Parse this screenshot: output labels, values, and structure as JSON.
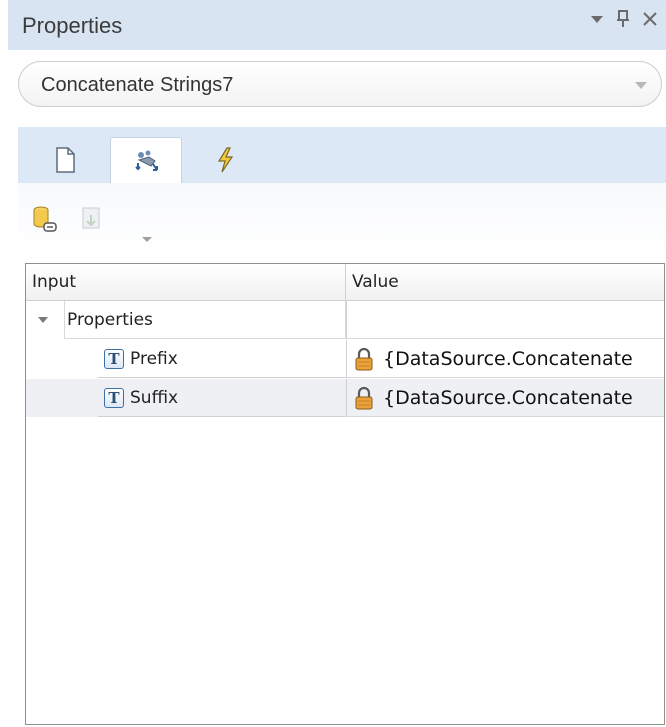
{
  "panel": {
    "title": "Properties",
    "controls": [
      "dropdown-menu-icon",
      "pin-icon",
      "close-icon"
    ]
  },
  "selector": {
    "value": "Concatenate Strings7"
  },
  "tabs": [
    {
      "icon": "document-icon",
      "active": false
    },
    {
      "icon": "data-mapping-icon",
      "active": true
    },
    {
      "icon": "event-lightning-icon",
      "active": false
    }
  ],
  "toolbar": {
    "items": [
      {
        "icon": "link-datasource-icon",
        "enabled": true
      },
      {
        "icon": "export-icon",
        "enabled": false
      }
    ]
  },
  "grid": {
    "columns": [
      "Input",
      "Value"
    ],
    "group": {
      "label": "Properties",
      "expanded": true
    },
    "rows": [
      {
        "name": "Prefix",
        "type_icon": "text-type-icon",
        "value": "{DataSource.Concatenate",
        "locked": true
      },
      {
        "name": "Suffix",
        "type_icon": "text-type-icon",
        "value": "{DataSource.Concatenate",
        "locked": true
      }
    ]
  },
  "colors": {
    "title_bar": "#d9e4f2",
    "tab_strip": "#dde8f6",
    "row_alt": "#eef0f4"
  }
}
